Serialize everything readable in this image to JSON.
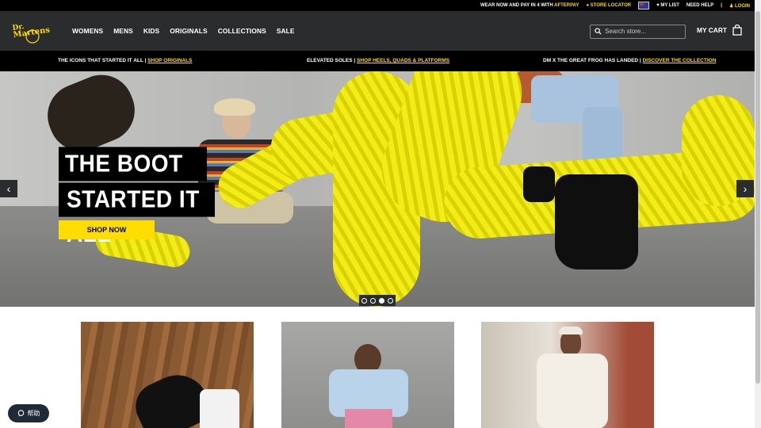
{
  "topbar": {
    "afterpay_text": "WEAR NOW AND PAY IN 4 WITH",
    "afterpay_brand": "AFTERPAY",
    "store_locator": "STORE LOCATOR",
    "my_list": "MY LIST",
    "need_help": "NEED HELP",
    "separator": "|",
    "login": "LOGIN"
  },
  "nav": {
    "items": [
      "WOMENS",
      "MENS",
      "KIDS",
      "ORIGINALS",
      "COLLECTIONS",
      "SALE"
    ]
  },
  "search": {
    "placeholder": "Search store..."
  },
  "cart": {
    "label": "MY CART"
  },
  "promos": [
    {
      "text": "THE ICONS THAT STARTED IT ALL |",
      "link": "SHOP ORIGINALS"
    },
    {
      "text": "ELEVATED SOLES |",
      "link": "SHOP HEELS, QUADS & PLATFORMS"
    },
    {
      "text": "DM X THE GREAT FROG HAS LANDED |",
      "link": "DISCOVER THE COLLECTION"
    }
  ],
  "hero": {
    "headline_line1": "THE BOOT THAT",
    "headline_line2": "STARTED IT ALL",
    "cta": "SHOP NOW",
    "prev": "‹",
    "next": "›",
    "slides_total": 4,
    "active_slide": 3
  },
  "help_widget": {
    "label": "帮助"
  },
  "colors": {
    "brand_yellow": "#ffdd00",
    "header_bg": "#2b2c2e",
    "black": "#000000"
  }
}
